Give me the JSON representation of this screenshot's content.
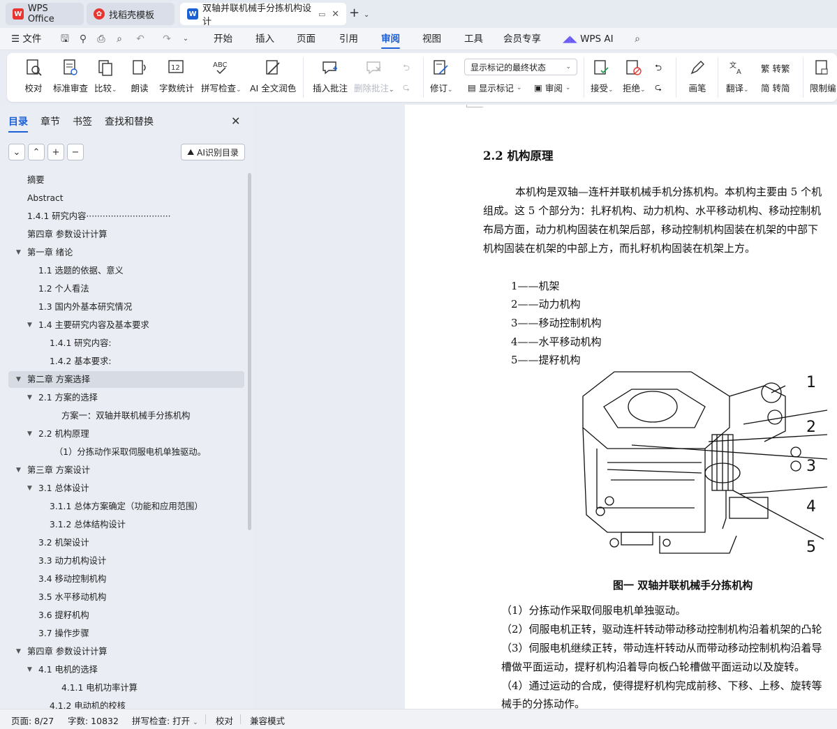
{
  "tabs": [
    {
      "label": "WPS Office"
    },
    {
      "label": "找稻壳模板"
    },
    {
      "label": "双轴并联机械手分拣机构设计"
    }
  ],
  "menu": {
    "file": "文件",
    "items": [
      "开始",
      "插入",
      "页面",
      "引用",
      "审阅",
      "视图",
      "工具",
      "会员专享"
    ],
    "active": "审阅",
    "wps_ai": "WPS AI"
  },
  "ribbon": {
    "proofread": "校对",
    "standard_review": "标准审查",
    "compare": "比较",
    "read_aloud": "朗读",
    "word_count": "字数统计",
    "spell_check": "拼写检查",
    "ai_polish": "AI 全文润色",
    "insert_comment": "插入批注",
    "delete_comment": "删除批注",
    "track": "修订",
    "show_mode": "显示标记的最终状态",
    "show_markup": "显示标记",
    "review": "审阅",
    "accept": "接受",
    "reject": "拒绝",
    "pen": "画笔",
    "translate": "翻译",
    "to_trad": "转繁",
    "to_simp": "转简",
    "restrict": "限制编"
  },
  "left_panel": {
    "tabs": [
      "目录",
      "章节",
      "书签",
      "查找和替换"
    ],
    "ai_button": "AI识别目录",
    "toc": [
      {
        "text": "摘要",
        "level": 1,
        "expand": false
      },
      {
        "text": "Abstract",
        "level": 1,
        "expand": false
      },
      {
        "text": "1.4.1  研究内容·······························",
        "level": 1,
        "expand": false
      },
      {
        "text": "第四章   参数设计计算",
        "level": 1,
        "expand": false
      },
      {
        "text": "第一章  绪论",
        "level": 1,
        "expand": true
      },
      {
        "text": "1.1 选题的依据、意义",
        "level": 2,
        "expand": false
      },
      {
        "text": "1.2   个人看法",
        "level": 2,
        "expand": false
      },
      {
        "text": "1.3   国内外基本研究情况",
        "level": 2,
        "expand": false
      },
      {
        "text": "1.4   主要研究内容及基本要求",
        "level": 2,
        "expand": true
      },
      {
        "text": "1.4.1   研究内容:",
        "level": 3,
        "expand": false
      },
      {
        "text": "1.4.2   基本要求:",
        "level": 3,
        "expand": false
      },
      {
        "text": "第二章  方案选择",
        "level": 1,
        "expand": true,
        "selected": true
      },
      {
        "text": "2.1  方案的选择",
        "level": 2,
        "expand": true
      },
      {
        "text": "方案一：双轴并联机械手分拣机构",
        "level": 4,
        "expand": false
      },
      {
        "text": "2.2  机构原理",
        "level": 2,
        "expand": true
      },
      {
        "text": "（1）分拣动作采取伺服电机单独驱动。",
        "level": 3.5,
        "expand": false
      },
      {
        "text": "第三章    方案设计",
        "level": 1,
        "expand": true
      },
      {
        "text": "3.1    总体设计",
        "level": 2,
        "expand": true
      },
      {
        "text": "3.1.1  总体方案确定（功能和应用范围）",
        "level": 3,
        "expand": false
      },
      {
        "text": "3.1.2  总体结构设计",
        "level": 3,
        "expand": false
      },
      {
        "text": "3.2    机架设计",
        "level": 2,
        "expand": false
      },
      {
        "text": "3.3    动力机构设计",
        "level": 2,
        "expand": false
      },
      {
        "text": "3.4    移动控制机构",
        "level": 2,
        "expand": false
      },
      {
        "text": "3.5    水平移动机构",
        "level": 2,
        "expand": false
      },
      {
        "text": "3.6    提籽机构",
        "level": 2,
        "expand": false
      },
      {
        "text": "3.7    操作步骤",
        "level": 2,
        "expand": false
      },
      {
        "text": "第四章  参数设计计算",
        "level": 1,
        "expand": true
      },
      {
        "text": "4.1  电机的选择",
        "level": 2,
        "expand": true
      },
      {
        "text": "4.1.1  电机功率计算",
        "level": 4,
        "expand": false
      },
      {
        "text": "4.1.2  电动机的校核",
        "level": 3,
        "expand": false
      }
    ]
  },
  "document": {
    "heading": "2.2  机构原理",
    "para1": [
      "本机构是双轴—连杆并联机械手机分拣机构。本机构主要由 5 个机",
      "组成。这 5 个部分为：扎籽机构、动力机构、水平移动机构、移动控制机",
      "布局方面，动力机构固装在机架后部，移动控制机构固装在机架的中部下",
      "机构固装在机架的中部上方，而扎籽机构固装在机架上方。"
    ],
    "parts": [
      "1——机架",
      "2——动力机构",
      "3——移动控制机构",
      "4——水平移动机构",
      "5——提籽机构"
    ],
    "figure_labels": [
      "1",
      "2",
      "3",
      "4",
      "5"
    ],
    "caption": "图一   双轴并联机械手分拣机构",
    "para2": [
      "（1）分拣动作采取伺服电机单独驱动。",
      "（2）伺服电机正转，驱动连杆转动带动移动控制机构沿着机架的凸轮",
      "（3）伺服电机继续正转，带动连杆转动从而带动移动控制机构沿着导",
      "槽做平面运动，提籽机构沿着导向板凸轮槽做平面运动以及旋转。",
      "（4）通过运动的合成，使得提籽机构完成前移、下移、上移、旋转等",
      "械手的分拣动作。"
    ]
  },
  "status": {
    "page": "页面: 8/27",
    "words": "字数: 10832",
    "spell": "拼写检查: 打开",
    "proof": "校对",
    "compat": "兼容模式"
  },
  "colors": {
    "accent": "#1a5fd6",
    "wps_red": "#e8352f"
  }
}
